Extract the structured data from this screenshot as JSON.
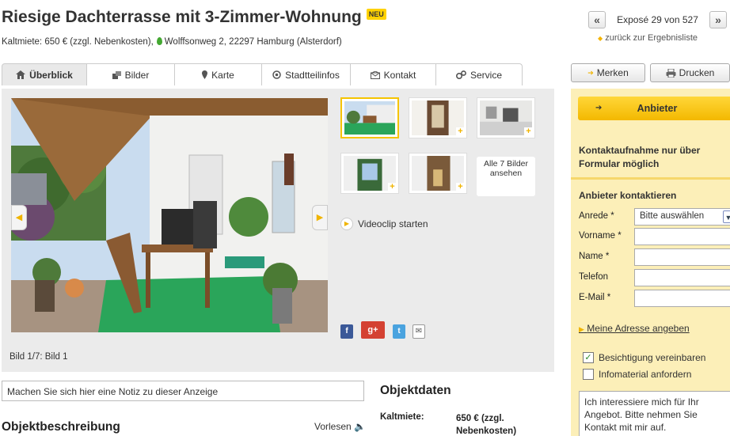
{
  "header": {
    "title": "Riesige Dachterrasse mit 3-Zimmer-Wohnung",
    "badge": "NEU",
    "kaltmiete_line": "Kaltmiete: 650 € (zzgl. Nebenkosten),",
    "address": "Wolffsonweg 2, 22297 Hamburg (Alsterdorf)"
  },
  "expose_nav": {
    "prev": "«",
    "next": "»",
    "count": "Exposé 29 von 527",
    "back_link": "zurück zur Ergebnisliste"
  },
  "tabs": [
    {
      "label": "Überblick",
      "icon": "home-icon",
      "active": true
    },
    {
      "label": "Bilder",
      "icon": "pictures-icon",
      "active": false
    },
    {
      "label": "Karte",
      "icon": "map-pin-icon",
      "active": false
    },
    {
      "label": "Stadtteilinfos",
      "icon": "info-icon",
      "active": false
    },
    {
      "label": "Kontakt",
      "icon": "mail-icon",
      "active": false
    },
    {
      "label": "Service",
      "icon": "gears-icon",
      "active": false
    }
  ],
  "actions": {
    "merken": "Merken",
    "drucken": "Drucken"
  },
  "gallery": {
    "caption": "Bild 1/7: Bild 1",
    "all_pictures": "Alle 7 Bilder ansehen",
    "video": "Videoclip starten"
  },
  "note_placeholder": "Machen Sie sich hier eine Notiz zu dieser Anzeige",
  "objektbeschreibung": {
    "heading": "Objektbeschreibung",
    "vorlesen": "Vorlesen"
  },
  "objektdaten": {
    "heading": "Objektdaten",
    "label": "Kaltmiete:",
    "value": "650 € (zzgl. Nebenkosten)"
  },
  "sidebar": {
    "anbieter_button": "Anbieter",
    "kontakt_info": "Kontaktaufnahme nur über Formular möglich",
    "contact_title": "Anbieter kontaktieren",
    "anrede_label": "Anrede *",
    "anrede_value": "Bitte auswählen",
    "vorname_label": "Vorname *",
    "name_label": "Name *",
    "telefon_label": "Telefon",
    "email_label": "E-Mail *",
    "address_link": "Meine Adresse angeben",
    "checkbox_besichtigung": "Besichtigung vereinbaren",
    "checkbox_infomaterial": "Infomaterial anfordern",
    "message": "Ich interessiere mich für Ihr Angebot. Bitte nehmen Sie Kontakt mit mir auf."
  },
  "colors": {
    "accent_yellow": "#ffd200",
    "sidebar_bg": "#fcefb8",
    "gallery_bg": "#ebebeb"
  }
}
